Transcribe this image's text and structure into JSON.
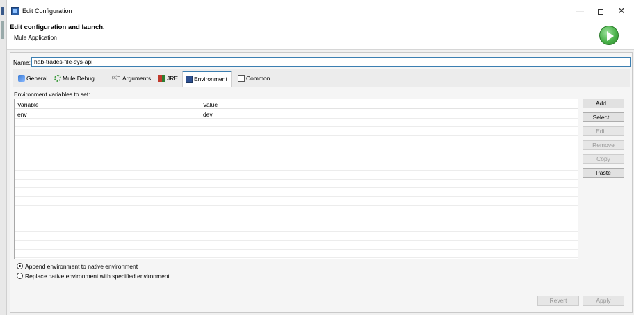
{
  "window": {
    "title": "Edit Configuration",
    "minimize_glyph": "—",
    "close_glyph": "✕"
  },
  "header": {
    "title": "Edit configuration and launch.",
    "subtitle": "Mule Application",
    "run_icon": "run-icon",
    "run_color": "#4bb34b"
  },
  "name_field": {
    "label": "Name:",
    "value": "hab-trades-file-sys-api"
  },
  "tabs": [
    {
      "label": "General",
      "icon": "general-icon"
    },
    {
      "label": "Mule Debug...",
      "icon": "debug-icon"
    },
    {
      "label": "Arguments",
      "icon": "arguments-icon",
      "icon_text": "(x)="
    },
    {
      "label": "JRE",
      "icon": "jre-icon"
    },
    {
      "label": "Environment",
      "icon": "environment-icon",
      "active": true
    },
    {
      "label": "Common",
      "icon": "common-icon"
    }
  ],
  "environment": {
    "section_label": "Environment variables to set:",
    "columns": [
      "Variable",
      "Value"
    ],
    "rows": [
      {
        "variable": "env",
        "value": "dev"
      }
    ]
  },
  "side_buttons": {
    "add": "Add...",
    "select": "Select...",
    "edit": "Edit...",
    "remove": "Remove",
    "copy": "Copy",
    "paste": "Paste"
  },
  "radios": {
    "append": {
      "label": "Append environment to native environment",
      "checked": true
    },
    "replace": {
      "label": "Replace native environment with specified environment",
      "checked": false
    }
  },
  "footer": {
    "revert": "Revert",
    "apply": "Apply"
  },
  "colors": {
    "accent": "#3c7fb1",
    "active_tab_border": "#3c7fb1"
  }
}
